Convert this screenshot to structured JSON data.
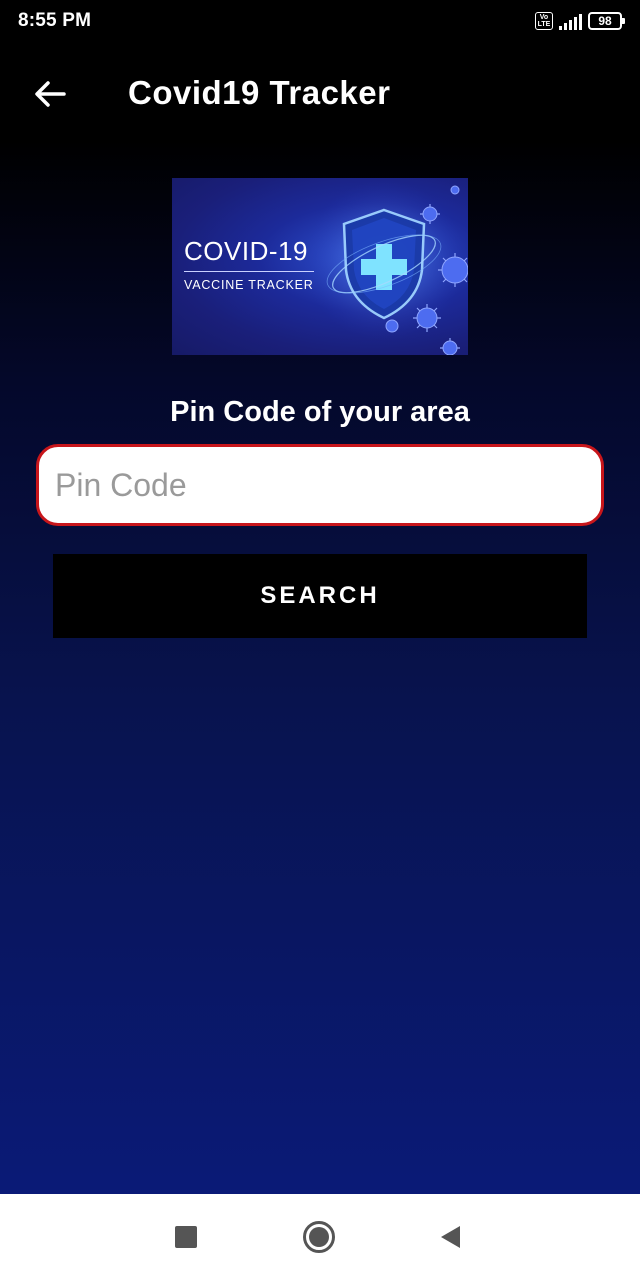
{
  "status_bar": {
    "time": "8:55 PM",
    "volte_icon": "VoLTE",
    "battery_level": "98"
  },
  "toolbar": {
    "back_icon": "arrow-back-icon",
    "title": "Covid19 Tracker"
  },
  "banner": {
    "title": "COVID-19",
    "subtitle": "VACCINE TRACKER"
  },
  "form": {
    "label": "Pin Code of your area",
    "input_placeholder": "Pin Code",
    "input_value": "",
    "search_label": "SEARCH",
    "input_border_color": "#c8161b"
  },
  "nav_bar": {
    "recents_icon": "square-icon",
    "home_icon": "circle-icon",
    "back_icon": "triangle-back-icon"
  }
}
